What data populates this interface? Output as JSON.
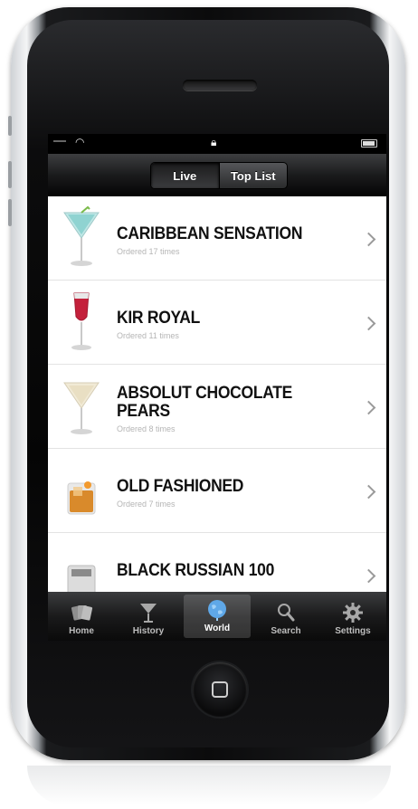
{
  "segmented": {
    "items": [
      "Live",
      "Top List"
    ],
    "selected": "Live"
  },
  "drinks": [
    {
      "name": "CARIBBEAN SENSATION",
      "subtitle": "Ordered 17 times",
      "icon": "martini-glass-blue-icon"
    },
    {
      "name": "KIR ROYAL",
      "subtitle": "Ordered 11 times",
      "icon": "champagne-flute-red-icon"
    },
    {
      "name": "ABSOLUT CHOCOLATE PEARS",
      "subtitle": "Ordered 8 times",
      "icon": "martini-glass-cream-icon"
    },
    {
      "name": "OLD FASHIONED",
      "subtitle": "Ordered 7 times",
      "icon": "rocks-glass-amber-icon"
    },
    {
      "name": "BLACK RUSSIAN 100",
      "subtitle": "",
      "icon": "rocks-glass-dark-icon"
    }
  ],
  "tabbar": {
    "items": [
      {
        "label": "Home",
        "icon": "cards-icon"
      },
      {
        "label": "History",
        "icon": "cocktail-glass-icon"
      },
      {
        "label": "World",
        "icon": "globe-icon"
      },
      {
        "label": "Search",
        "icon": "search-icon"
      },
      {
        "label": "Settings",
        "icon": "gear-icon"
      }
    ],
    "selected": "World"
  },
  "colors": {
    "bar_dark": "#1b1c1d",
    "title_text": "#111111",
    "subtitle_text": "#b5b5b5"
  }
}
